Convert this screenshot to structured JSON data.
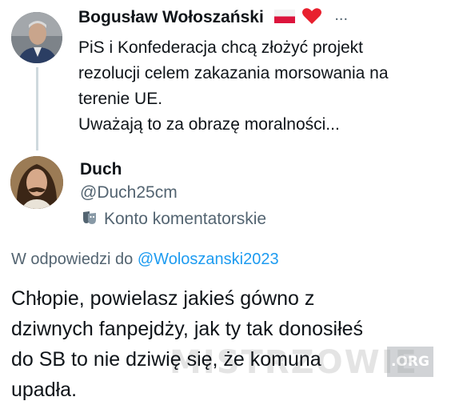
{
  "parent_tweet": {
    "author_name": "Bogusław Wołoszański",
    "more": "...",
    "text_lines": [
      "PiS i Konfederacja chcą złożyć projekt",
      "rezolucji celem zakazania morsowania na",
      "terenie UE.",
      "Uważają to za obrazę moralności..."
    ]
  },
  "reply_tweet": {
    "author_name": "Duch",
    "handle": "@Duch25cm",
    "account_label": "Konto komentatorskie",
    "reply_prefix": "W odpowiedzi do",
    "reply_to_handle": "@Woloszanski2023",
    "text_lines": [
      "Chłopie, powielasz jakieś gówno z",
      "dziwnych fanpejdży, jak ty tak donosiłeś",
      "do SB to nie dziwię się, że komuna",
      "upadła."
    ]
  },
  "watermark": {
    "text": "MISTRZOWIE",
    "suffix": ".ORG"
  },
  "colors": {
    "text": "#0f1419",
    "secondary": "#536471",
    "link": "#1d9bf0",
    "thread_line": "#cfd9de"
  }
}
